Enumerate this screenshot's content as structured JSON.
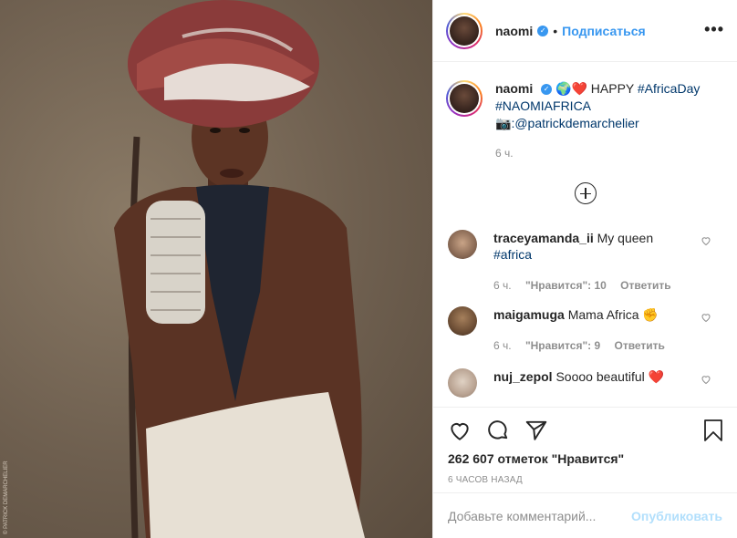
{
  "post": {
    "username": "naomi",
    "follow_label": "Подписаться",
    "more_label": "•••",
    "dot": "•",
    "caption": {
      "username": "naomi",
      "emojis": "🌍❤️",
      "text_1": "HAPPY",
      "tag_1": "#AfricaDay",
      "tag_2": "#NAOMIAFRICA",
      "camera_emoji": "📷",
      "credit": ":@patrickdemarchelier",
      "time": "6 ч."
    },
    "comments": [
      {
        "username": "traceyamanda_ii",
        "text": "My queen",
        "tag": "#africa",
        "time": "6 ч.",
        "likes": "\"Нравится\": 10",
        "reply": "Ответить"
      },
      {
        "username": "maigamuga",
        "text": "Mama Africa",
        "emoji": "✊",
        "time": "6 ч.",
        "likes": "\"Нравится\": 9",
        "reply": "Ответить"
      },
      {
        "username": "nuj_zepol",
        "text": "Soooo beautiful",
        "emoji": "❤️"
      }
    ],
    "likes_count": "262 607 отметок \"Нравится\"",
    "time_ago": "6 часов назад",
    "comment_placeholder": "Добавьте комментарий...",
    "publish_label": "Опубликовать",
    "photo_credit": "© PATRICK DEMARCHELIER"
  },
  "icons": {
    "verified": "verified-badge-icon",
    "heart": "heart-icon",
    "comment": "comment-icon",
    "share": "share-icon",
    "bookmark": "bookmark-icon",
    "load_more": "plus-circle-icon"
  },
  "colors": {
    "accent": "#3897f0",
    "publish_disabled": "#b2dffc",
    "text": "#262626",
    "muted": "#8e8e8e"
  }
}
